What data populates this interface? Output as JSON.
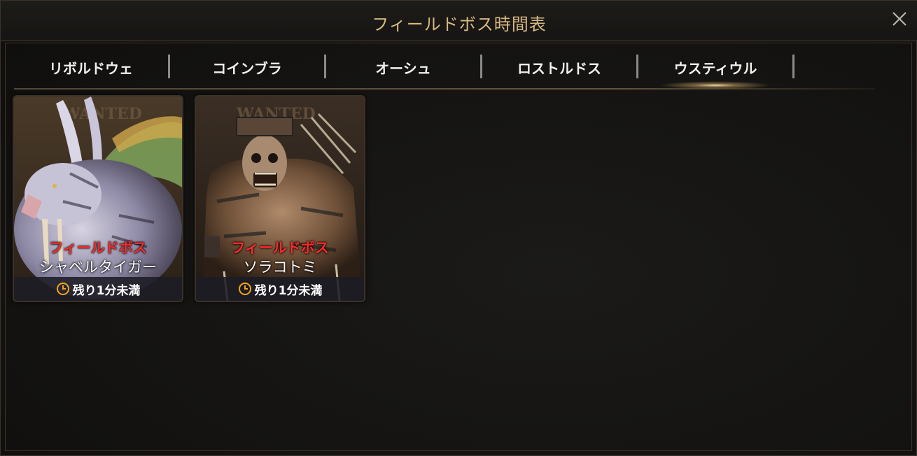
{
  "window": {
    "title": "フィールドボス時間表"
  },
  "tabs": [
    {
      "label": "リボルドウェ",
      "active": false
    },
    {
      "label": "コインブラ",
      "active": false
    },
    {
      "label": "オーシュ",
      "active": false
    },
    {
      "label": "ロストルドス",
      "active": false
    },
    {
      "label": "ウスティウル",
      "active": true
    }
  ],
  "bosses": [
    {
      "category": "フィールドボス",
      "name": "シャベルタイガー",
      "time_left": "残り1分未満",
      "poster_text": "WANTED"
    },
    {
      "category": "フィールドボス",
      "name": "ソラコトミ",
      "time_left": "残り1分未満",
      "poster_text": "WANTED"
    }
  ],
  "icons": {
    "close": "close-icon",
    "clock": "clock-icon"
  },
  "colors": {
    "title_gold": "#d8b981",
    "category_red": "#ff2a2a",
    "clock_orange": "#f2a31b"
  }
}
